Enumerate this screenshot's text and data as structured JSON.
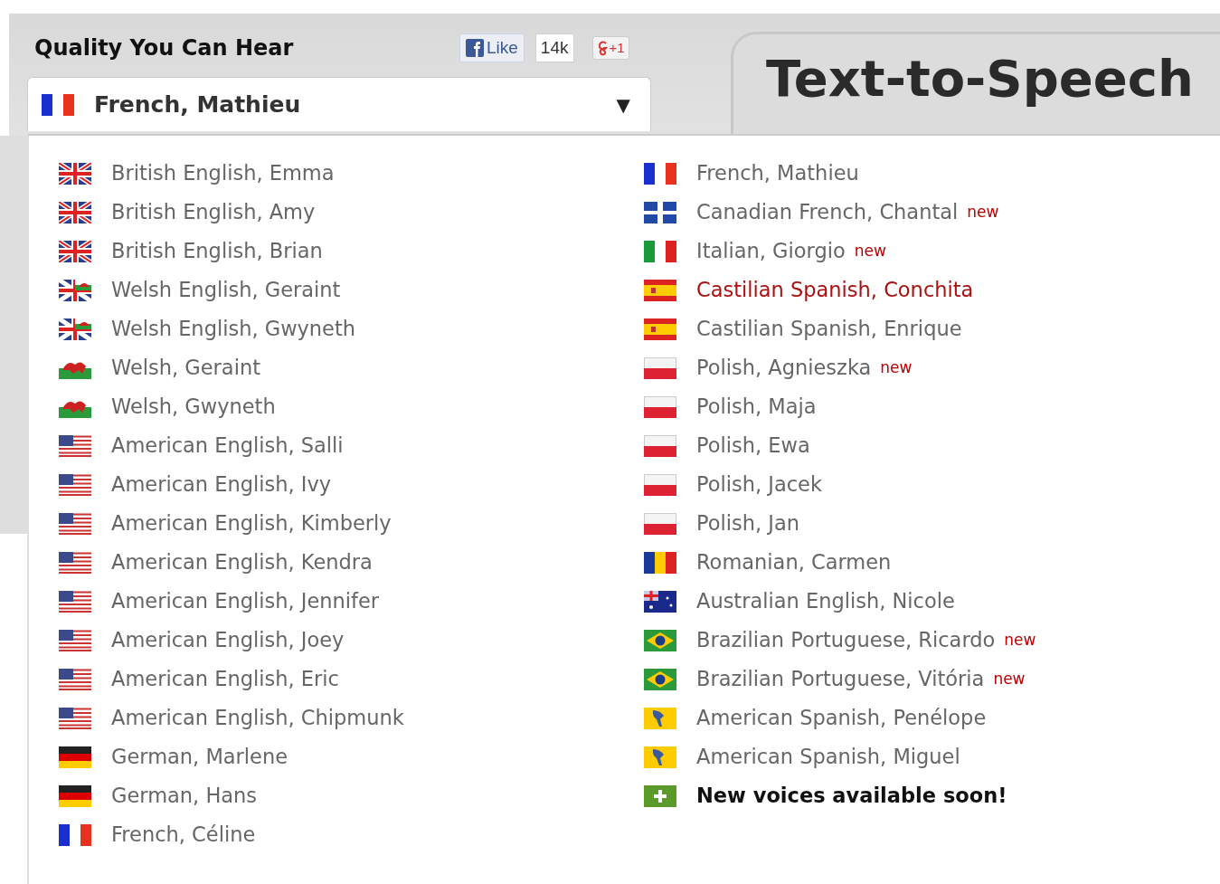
{
  "header": {
    "title": "Quality You Can Hear",
    "like_button": "Like",
    "like_count": "14k",
    "plus_button": "+1"
  },
  "voice_select": {
    "kind": "fr",
    "value": "French, Mathieu",
    "caret": "▼"
  },
  "product_tab": {
    "title": "Text-to-Speech"
  },
  "voice_columns": [
    [
      {
        "kind": "gb",
        "label": "British English, Emma",
        "highlighted": false
      },
      {
        "kind": "gb",
        "label": "British English, Amy",
        "highlighted": false
      },
      {
        "kind": "gb",
        "label": "British English, Brian",
        "highlighted": false
      },
      {
        "kind": "gbw",
        "label": "Welsh English, Geraint",
        "highlighted": false
      },
      {
        "kind": "gbw",
        "label": "Welsh English, Gwyneth",
        "highlighted": false
      },
      {
        "kind": "wales",
        "label": "Welsh, Geraint",
        "highlighted": false
      },
      {
        "kind": "wales",
        "label": "Welsh, Gwyneth",
        "highlighted": false
      },
      {
        "kind": "us",
        "label": "American English, Salli",
        "highlighted": false
      },
      {
        "kind": "us",
        "label": "American English, Ivy",
        "highlighted": false
      },
      {
        "kind": "us",
        "label": "American English, Kimberly",
        "highlighted": false
      },
      {
        "kind": "us",
        "label": "American English, Kendra",
        "highlighted": false
      },
      {
        "kind": "us",
        "label": "American English, Jennifer",
        "highlighted": false
      },
      {
        "kind": "us",
        "label": "American English, Joey",
        "highlighted": false
      },
      {
        "kind": "us",
        "label": "American English, Eric",
        "highlighted": false
      },
      {
        "kind": "us",
        "label": "American English, Chipmunk",
        "highlighted": false
      },
      {
        "kind": "de",
        "label": "German, Marlene",
        "highlighted": false
      },
      {
        "kind": "de",
        "label": "German, Hans",
        "highlighted": false
      },
      {
        "kind": "fr",
        "label": "French, Céline",
        "highlighted": false
      }
    ],
    [
      {
        "kind": "fr",
        "label": "French, Mathieu",
        "highlighted": false
      },
      {
        "kind": "qc",
        "label": "Canadian French, Chantal",
        "badge": "new",
        "highlighted": false
      },
      {
        "kind": "it",
        "label": "Italian, Giorgio",
        "badge": "new",
        "highlighted": false
      },
      {
        "kind": "es",
        "label": "Castilian Spanish, Conchita",
        "highlighted": true
      },
      {
        "kind": "es",
        "label": "Castilian Spanish, Enrique",
        "highlighted": false
      },
      {
        "kind": "pl",
        "label": "Polish, Agnieszka",
        "badge": "new",
        "highlighted": false
      },
      {
        "kind": "pl",
        "label": "Polish, Maja",
        "highlighted": false
      },
      {
        "kind": "pl",
        "label": "Polish, Ewa",
        "highlighted": false
      },
      {
        "kind": "pl",
        "label": "Polish, Jacek",
        "highlighted": false
      },
      {
        "kind": "pl",
        "label": "Polish, Jan",
        "highlighted": false
      },
      {
        "kind": "ro",
        "label": "Romanian, Carmen",
        "highlighted": false
      },
      {
        "kind": "au",
        "label": "Australian English, Nicole",
        "highlighted": false
      },
      {
        "kind": "br",
        "label": "Brazilian Portuguese, Ricardo",
        "badge": "new",
        "highlighted": false
      },
      {
        "kind": "br",
        "label": "Brazilian Portuguese, Vitória",
        "badge": "new",
        "highlighted": false
      },
      {
        "kind": "latam",
        "label": "American Spanish, Penélope",
        "highlighted": false
      },
      {
        "kind": "latam",
        "label": "American Spanish, Miguel",
        "highlighted": false
      },
      {
        "kind": "plus",
        "label": "New voices available soon!",
        "highlighted": false
      }
    ]
  ]
}
